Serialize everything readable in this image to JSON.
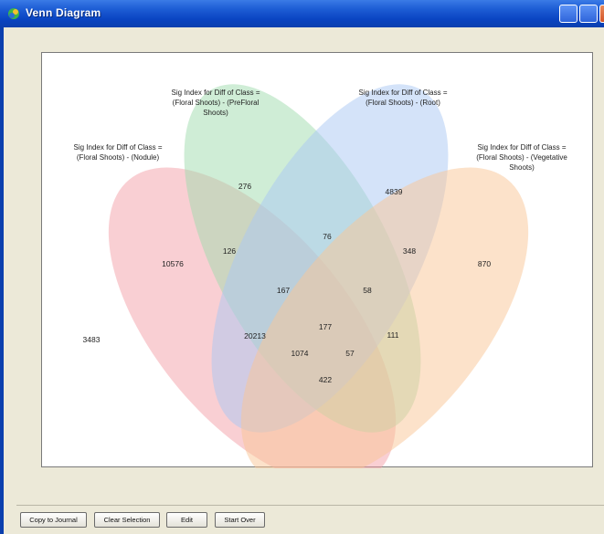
{
  "window": {
    "title": "Venn Diagram"
  },
  "diagram": {
    "sets": [
      {
        "label": "Sig Index for Diff of Class =\n(Floral Shoots) - (Nodule)",
        "color": "#f4a0a8"
      },
      {
        "label": "Sig Index for Diff of Class =\n(Floral Shoots) - (PreFloral\nShoots)",
        "color": "#9fdcae"
      },
      {
        "label": "Sig Index for Diff of Class =\n(Floral Shoots) - (Root)",
        "color": "#a9c8f3"
      },
      {
        "label": "Sig Index for Diff of Class =\n(Floral Shoots) - (Vegetative\nShoots)",
        "color": "#f9c596"
      }
    ],
    "regions": [
      {
        "region": "A only",
        "value": "10576"
      },
      {
        "region": "B only",
        "value": "276"
      },
      {
        "region": "C only",
        "value": "4839"
      },
      {
        "region": "D only",
        "value": "870"
      },
      {
        "region": "A∩B",
        "value": "126"
      },
      {
        "region": "B∩C",
        "value": "76"
      },
      {
        "region": "C∩D",
        "value": "348"
      },
      {
        "region": "A∩B∩C",
        "value": "167"
      },
      {
        "region": "B∩C∩D",
        "value": "58"
      },
      {
        "region": "A∩B∩C∩D",
        "value": "177"
      },
      {
        "region": "A∩C",
        "value": "20213"
      },
      {
        "region": "B∩D",
        "value": "111"
      },
      {
        "region": "A∩C∩D",
        "value": "1074"
      },
      {
        "region": "A∩B∩D",
        "value": "57"
      },
      {
        "region": "A∩D",
        "value": "422"
      },
      {
        "region": "outside",
        "value": "3483"
      }
    ]
  },
  "buttons": {
    "copy_to_journal": "Copy to Journal",
    "clear_selection": "Clear Selection",
    "edit": "Edit",
    "start_over": "Start Over"
  }
}
